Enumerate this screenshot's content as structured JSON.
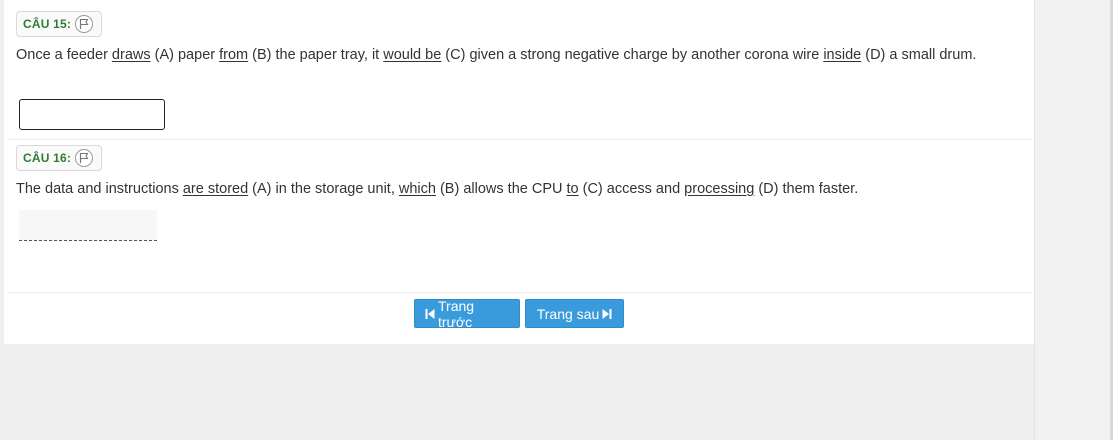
{
  "questions": [
    {
      "label": "CÂU 15:",
      "segments": [
        {
          "t": "Once a feeder ",
          "u": false
        },
        {
          "t": "draws",
          "u": true
        },
        {
          "t": " (A) paper ",
          "u": false
        },
        {
          "t": "from",
          "u": true
        },
        {
          "t": " (B) the paper tray, it ",
          "u": false
        },
        {
          "t": "would be",
          "u": true
        },
        {
          "t": " (C) given a strong negative charge by another corona wire ",
          "u": false
        },
        {
          "t": "inside",
          "u": true
        },
        {
          "t": " (D) a small drum.",
          "u": false
        }
      ],
      "answer": ""
    },
    {
      "label": "CÂU 16:",
      "segments": [
        {
          "t": "The data and instructions ",
          "u": false
        },
        {
          "t": "are stored",
          "u": true
        },
        {
          "t": " (A) in the storage unit, ",
          "u": false
        },
        {
          "t": "which",
          "u": true
        },
        {
          "t": " (B) allows the CPU ",
          "u": false
        },
        {
          "t": "to",
          "u": true
        },
        {
          "t": " (C) access and ",
          "u": false
        },
        {
          "t": "processing",
          "u": true
        },
        {
          "t": " (D) them faster.",
          "u": false
        }
      ],
      "answer": ""
    }
  ],
  "navigation": {
    "prev_label": "Trang trước",
    "next_label": "Trang sau",
    "prev_icon": "skip-back-icon",
    "next_icon": "skip-forward-icon"
  },
  "colors": {
    "question_label": "#2e7d32",
    "button_bg": "#3a9bdc",
    "page_bg": "#efefef"
  }
}
